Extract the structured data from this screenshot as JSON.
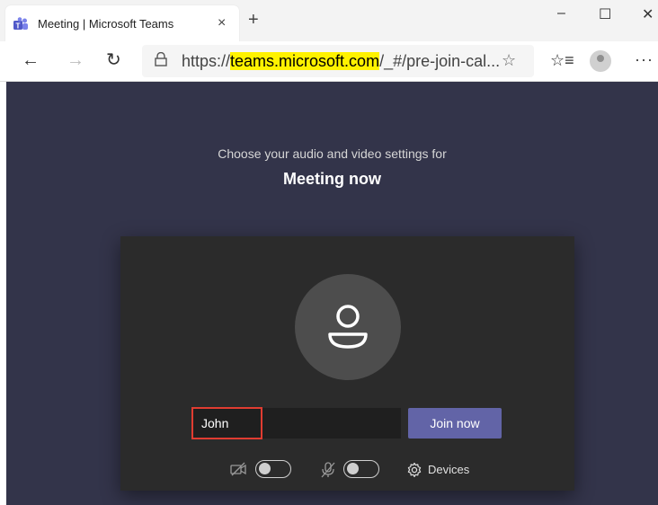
{
  "browser": {
    "tab": {
      "title": "Meeting | Microsoft Teams",
      "close_glyph": "×"
    },
    "new_tab_glyph": "+",
    "window_controls": {
      "minimize": "–",
      "maximize": "☐",
      "close": "✕"
    },
    "nav": {
      "back": "←",
      "forward": "→",
      "refresh": "↻"
    },
    "url": {
      "prefix": "https://",
      "domain": "teams.microsoft.com",
      "path": "/_#/pre-join-cal..."
    },
    "star_glyph": "☆",
    "favorites_glyph": "☆≡",
    "more_glyph": "···"
  },
  "prejoin": {
    "subtitle": "Choose your audio and video settings for",
    "meeting_title": "Meeting now",
    "name_value": "John",
    "join_label": "Join now",
    "devices_label": "Devices",
    "camera_on": false,
    "mic_on": false
  },
  "colors": {
    "content_bg": "#33344a",
    "panel_bg": "#2b2b2b",
    "join_button": "#6264a7",
    "highlight_border": "#e03c31",
    "url_highlight": "#fff200"
  },
  "icons": [
    "teams-favicon",
    "lock-icon",
    "camera-off-icon",
    "mic-off-icon",
    "gear-icon",
    "avatar-icon"
  ]
}
